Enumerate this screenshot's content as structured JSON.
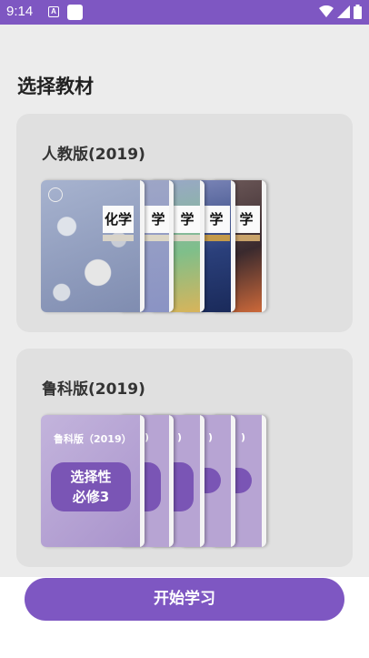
{
  "status_bar": {
    "time": "9:14",
    "notif_letter": "A"
  },
  "page": {
    "title": "选择教材"
  },
  "textbooks": [
    {
      "edition": "人教版(2019)",
      "cover_title": "化学",
      "cover_title_partial": "学"
    },
    {
      "edition": "鲁科版(2019)",
      "cover_edition": "鲁科版（2019）",
      "cover_partial": ")",
      "cover_badge_line1": "选择性",
      "cover_badge_line2": "必修3"
    }
  ],
  "actions": {
    "start_label": "开始学习"
  },
  "colors": {
    "accent": "#7e57c2",
    "card_bg": "#e0e0e0",
    "page_bg": "#ececec"
  }
}
